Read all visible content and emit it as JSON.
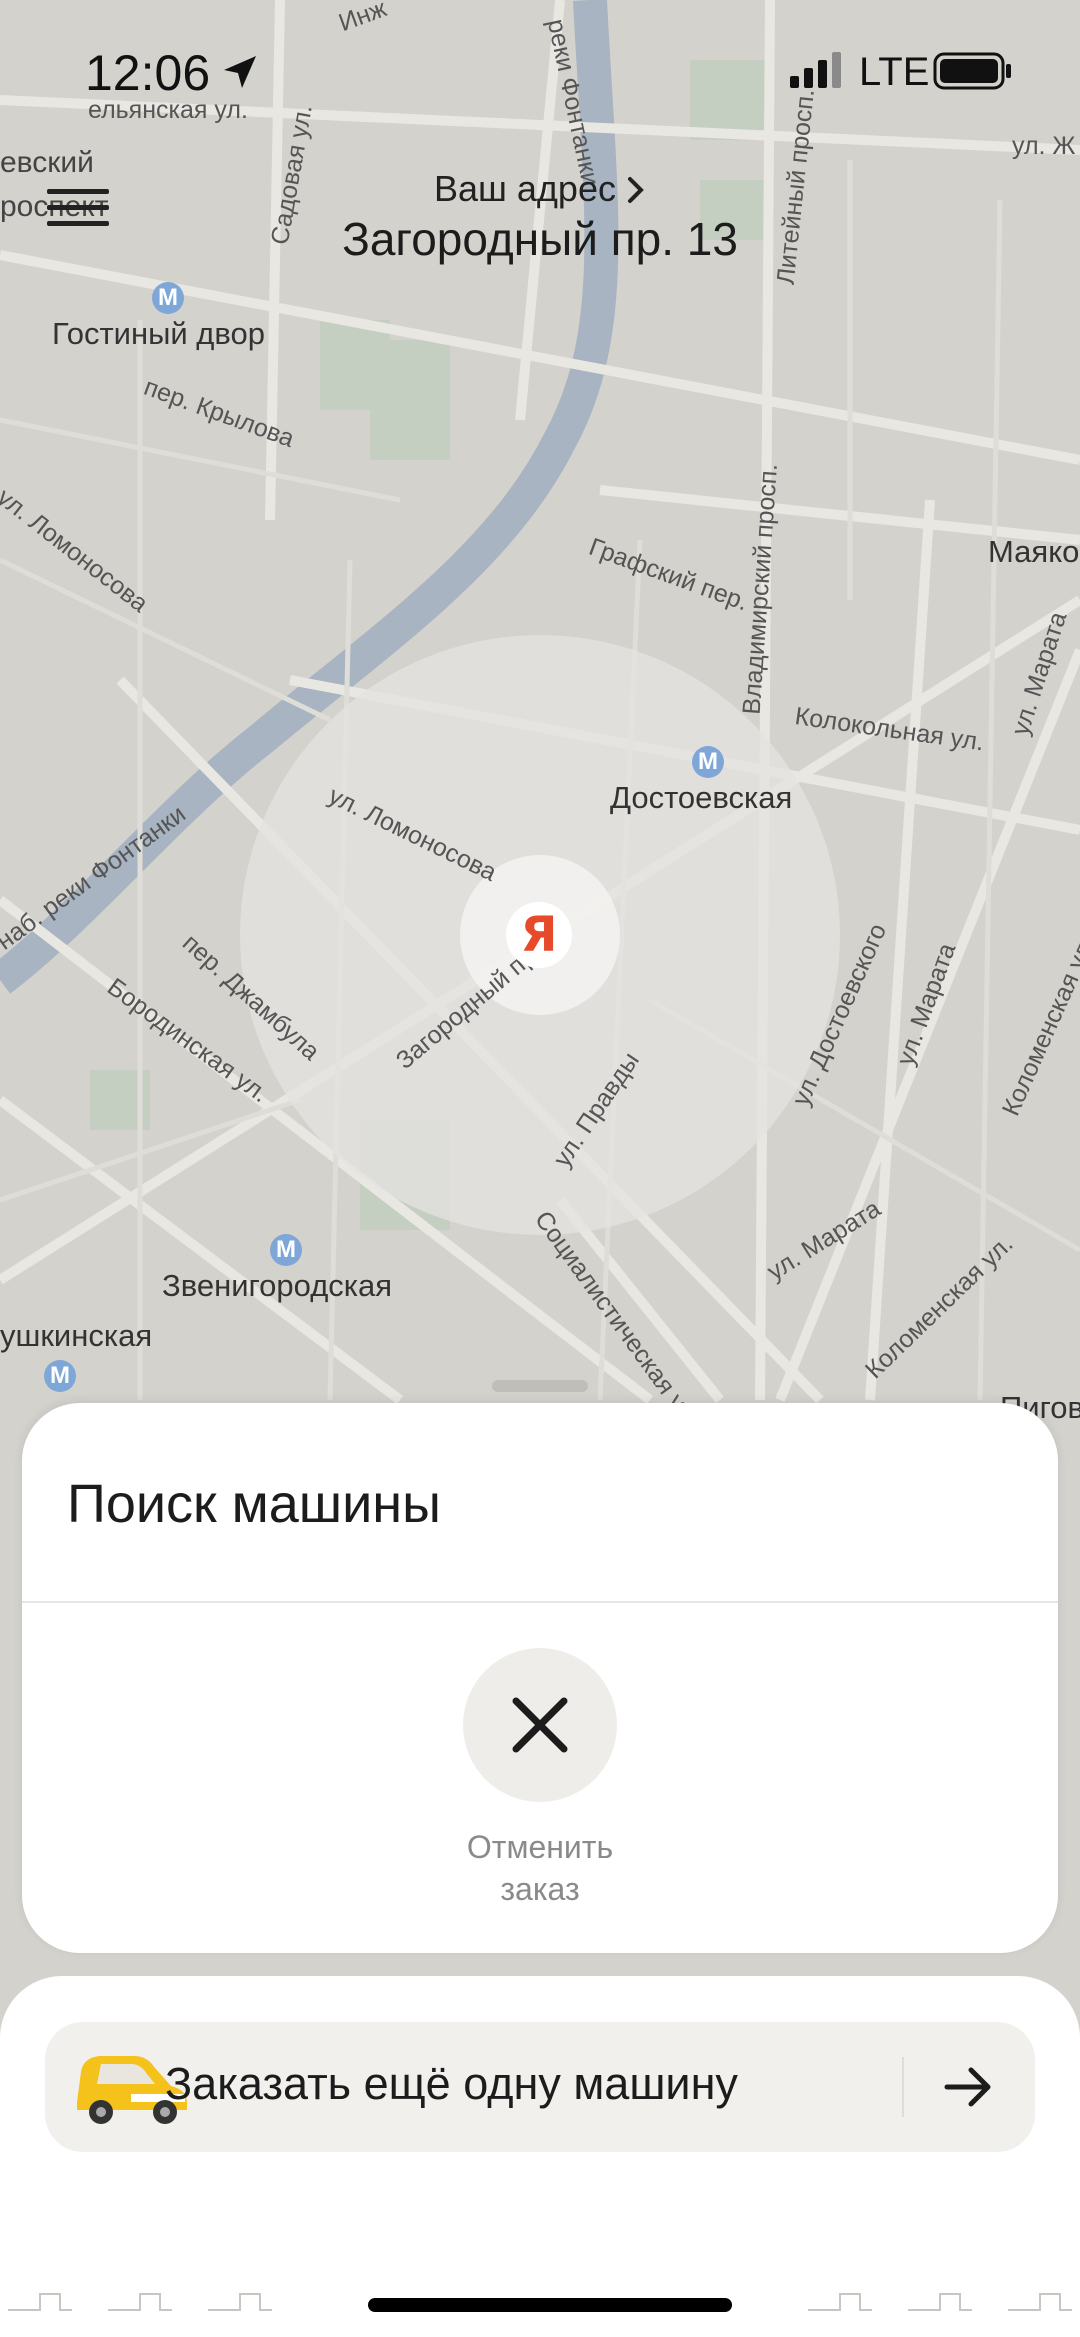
{
  "status_bar": {
    "time": "12:06",
    "network": "LTE"
  },
  "header": {
    "address_caption": "Ваш адрес",
    "address_value": "Загородный пр. 13"
  },
  "map": {
    "metro_stations": [
      "Гостиный двор",
      "Достоевская",
      "Звенигородская",
      "ушкинская",
      "Маяко",
      "Пигов"
    ],
    "streets": [
      "ельянская ул.",
      "Садовая ул.",
      "реки Фонтанки",
      "Литейный просп.",
      "ул. Ж",
      "пер. Крылова",
      "Графский пер.",
      "Владимирский просп.",
      "Колокольная ул.",
      "ул. Марата",
      "ул. Ломоносова",
      "Загородный просп.",
      "пер. Джамбула",
      "Бородинская ул.",
      "ул. Правды",
      "ул. Достоевского",
      "Коломенская ул.",
      "Социалистическая ул.",
      "наб. реки Фонтанки",
      "евский",
      "роспект",
      "Инж",
      "ул. Ломоносова"
    ],
    "pin_letter": "Я",
    "icons": [
      "location-arrow-icon",
      "signal-icon",
      "battery-icon",
      "menu-icon",
      "chevron-right-icon",
      "metro-icon",
      "close-icon",
      "car-icon",
      "arrow-right-icon"
    ]
  },
  "search_sheet": {
    "title": "Поиск машины",
    "cancel_line1": "Отменить",
    "cancel_line2": "заказ"
  },
  "bottom_card": {
    "order_another_label": "Заказать ещё одну машину"
  },
  "colors": {
    "map_bg": "#d4d2cd",
    "river": "#a8b4c2",
    "pin_red": "#e64a2a",
    "car_yellow": "#f4c21a"
  }
}
